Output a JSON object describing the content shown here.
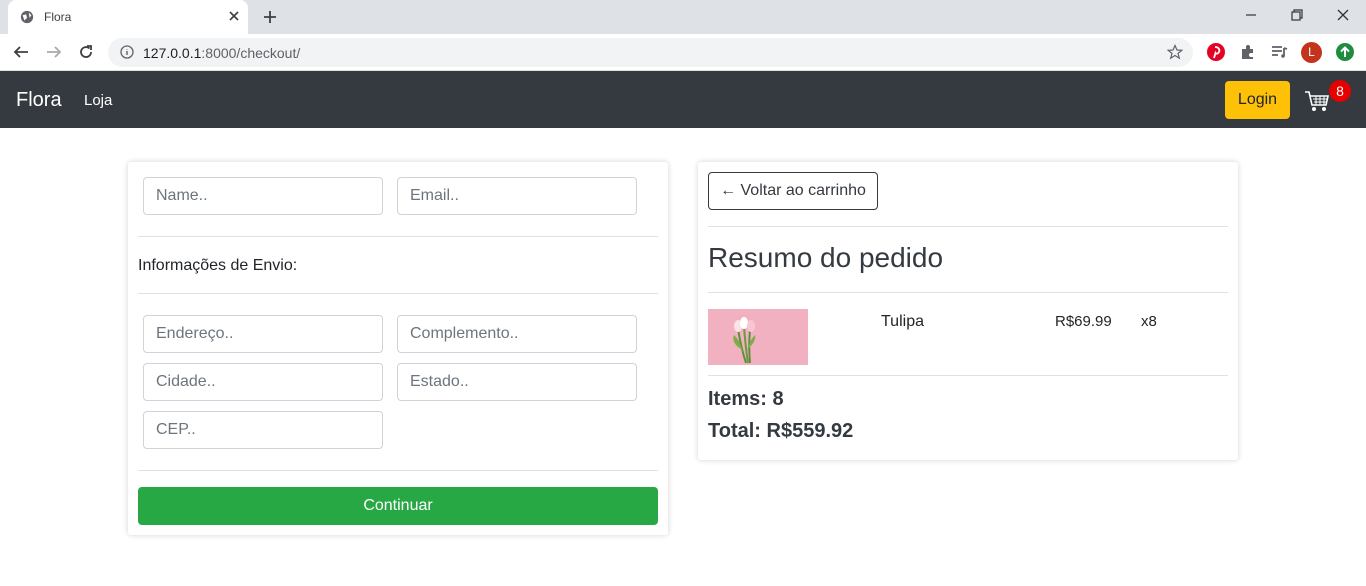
{
  "browser": {
    "tab_title": "Flora",
    "url_host": "127.0.0.1",
    "url_path": ":8000/checkout/",
    "profile_initial": "L"
  },
  "navbar": {
    "brand": "Flora",
    "link_store": "Loja",
    "login_label": "Login",
    "cart_count": "8"
  },
  "form": {
    "name_placeholder": "Name..",
    "email_placeholder": "Email..",
    "shipping_heading": "Informações de Envio:",
    "address_placeholder": "Endereço..",
    "complement_placeholder": "Complemento..",
    "city_placeholder": "Cidade..",
    "state_placeholder": "Estado..",
    "zip_placeholder": "CEP..",
    "continue_label": "Continuar"
  },
  "summary": {
    "back_label": "← Voltar ao carrinho",
    "title": "Resumo do pedido",
    "items": [
      {
        "name": "Tulipa",
        "price": "R$69.99",
        "qty": "x8"
      }
    ],
    "items_total": "Items: 8",
    "grand_total": "Total: R$559.92"
  },
  "colors": {
    "navbar": "#343a40",
    "login": "#ffc107",
    "continue": "#28a745",
    "badge": "#e60000"
  }
}
